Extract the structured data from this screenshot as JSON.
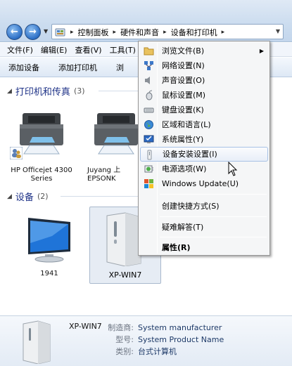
{
  "breadcrumb": {
    "items": [
      "控制面板",
      "硬件和声音",
      "设备和打印机"
    ]
  },
  "menubar": {
    "items": [
      "文件(F)",
      "编辑(E)",
      "查看(V)",
      "工具(T)"
    ]
  },
  "toolbar": {
    "add_device": "添加设备",
    "add_printer": "添加打印机",
    "third": "浏"
  },
  "groups": {
    "printers": {
      "title": "打印机和传真",
      "count": "(3)"
    },
    "devices": {
      "title": "设备",
      "count": "(2)"
    }
  },
  "printers": [
    {
      "name_line1": "HP Officejet 4300",
      "name_line2": "Series"
    },
    {
      "name_line1": "Juyang 上",
      "name_line2": "EPSONK"
    }
  ],
  "devices": [
    {
      "name": "1941"
    },
    {
      "name": "XP-WIN7"
    }
  ],
  "context_menu": {
    "items": [
      {
        "label": "浏览文件(B)",
        "icon": "folder-icon",
        "submenu": true
      },
      {
        "label": "网络设置(N)",
        "icon": "network-icon"
      },
      {
        "label": "声音设置(O)",
        "icon": "speaker-icon"
      },
      {
        "label": "鼠标设置(M)",
        "icon": "mouse-icon"
      },
      {
        "label": "键盘设置(K)",
        "icon": "keyboard-icon"
      },
      {
        "label": "区域和语言(L)",
        "icon": "globe-icon"
      },
      {
        "label": "系统属性(Y)",
        "icon": "system-icon"
      },
      {
        "label": "设备安装设置(I)",
        "icon": "device-icon",
        "highlighted": true
      },
      {
        "label": "电源选项(W)",
        "icon": "power-icon"
      },
      {
        "label": "Windows Update(U)",
        "icon": "windows-update-icon"
      },
      {
        "label": "创建快捷方式(S)"
      },
      {
        "label": "疑难解答(T)"
      },
      {
        "label": "属性(R)",
        "bold": true
      }
    ]
  },
  "details": {
    "name": "XP-WIN7",
    "manufacturer_label": "制造商:",
    "manufacturer": "System manufacturer",
    "model_label": "型号:",
    "model": "System Product Name",
    "category_label": "类别:",
    "category": "台式计算机"
  },
  "colors": {
    "group_header": "#1e3287",
    "highlight_border": "#a8c2e5",
    "detail_value": "#1e3a68"
  }
}
